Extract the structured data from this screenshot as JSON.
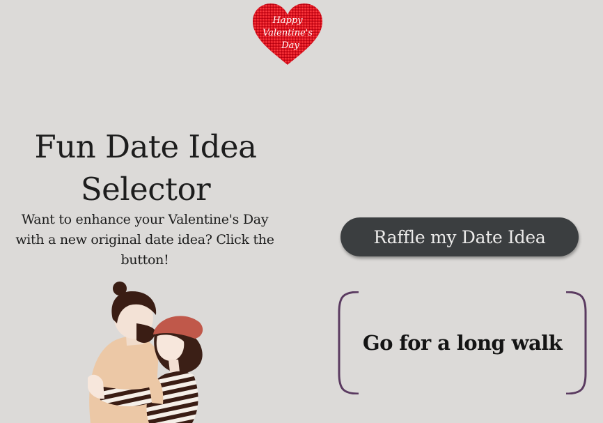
{
  "header": {
    "logo_text_line1": "Happy",
    "logo_text_line2": "Valentine's",
    "logo_text_line3": "Day",
    "logo_color": "#e0121f"
  },
  "intro": {
    "title": "Fun Date Idea Selector",
    "description": "Want to enhance your Valentine's Day with a new original date idea? Click the button!"
  },
  "illustration": {
    "name": "couple-hugging-illustration"
  },
  "actions": {
    "raffle_label": "Raffle my Date Idea"
  },
  "result": {
    "idea": "Go for a long walk",
    "border_color": "#5a3a60"
  }
}
